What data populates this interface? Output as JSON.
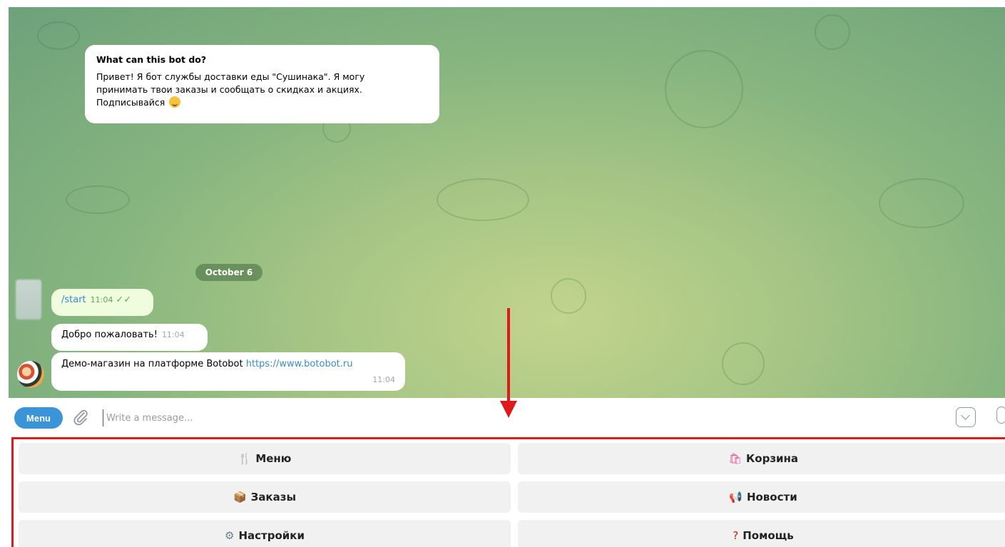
{
  "intro": {
    "title": "What can this bot do?",
    "body": "Привет! Я бот службы доставки еды \"Сушинака\". Я могу\nпринимать твои заказы и сообщать о скидках и акциях.\nПодписывайся"
  },
  "date_separator": "October 6",
  "messages": [
    {
      "direction": "out",
      "text": "/start",
      "time": "11:04"
    },
    {
      "direction": "in",
      "text": "Добро пожаловать!",
      "time": "11:04"
    },
    {
      "direction": "in",
      "text": "Демо-магазин на платформе Botobot",
      "link": "https://www.botobot.ru",
      "time": "11:04"
    }
  ],
  "composer": {
    "menu_label": "Menu",
    "placeholder": "Write a message..."
  },
  "keyboard": {
    "buttons": [
      {
        "label": "Меню",
        "icon": "fork-knife-icon"
      },
      {
        "label": "Корзина",
        "icon": "shopping-bag-icon"
      },
      {
        "label": "Заказы",
        "icon": "package-icon"
      },
      {
        "label": "Новости",
        "icon": "megaphone-icon"
      },
      {
        "label": "Настройки",
        "icon": "gear-icon"
      },
      {
        "label": "Помощь",
        "icon": "question-mark-icon"
      }
    ]
  },
  "colors": {
    "accent": "#3a95d8",
    "highlight": "#e0191b",
    "outgoing_bubble": "#effdde"
  }
}
